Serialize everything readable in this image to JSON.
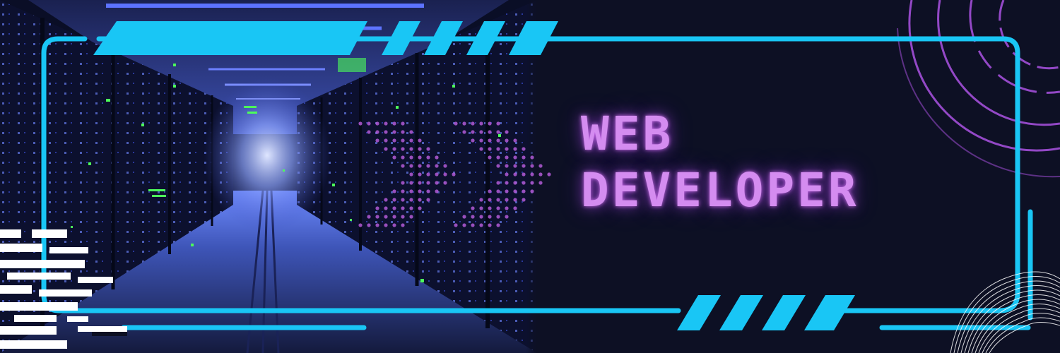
{
  "banner": {
    "title_line_1": "WEB",
    "title_line_2": "DEVELOPER"
  },
  "colors": {
    "frame": "#19c6f5",
    "title": "#d48cf0",
    "accent_purple": "#a24fd8",
    "background": "#0d1024",
    "server_light": "#6d86ff",
    "status_led": "#4cff5a"
  },
  "icons": {
    "arrows": "double-chevron-right-icon",
    "rings": "concentric-rings-icon",
    "fingerprint": "wavy-lines-icon"
  }
}
